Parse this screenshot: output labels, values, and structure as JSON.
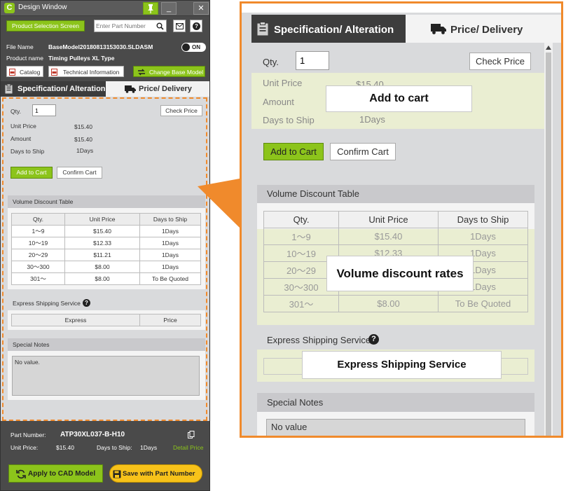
{
  "window": {
    "title": "Design Window",
    "logo_letter": "C",
    "minimize_glyph": "_",
    "close_glyph": "✕",
    "product_selection_label": "Product Selection Screen",
    "search_placeholder": "Enter Part Number",
    "file_name_label": "File Name",
    "file_name_value": "BaseModel20180813153030.SLDASM",
    "toggle_label": "ON",
    "product_name_label": "Product name",
    "product_name_value": "Timing Pulleys XL Type",
    "catalog_label": "Catalog",
    "tech_info_label": "Technical Information",
    "change_base_label": "Change Base Model"
  },
  "tabs": {
    "spec": "Specification/ Alteration",
    "price": "Price/ Delivery"
  },
  "price": {
    "qty_label": "Qty.",
    "qty_value": "1",
    "check_price": "Check Price",
    "unit_price_label": "Unit Price",
    "unit_price_value": "$15.40",
    "amount_label": "Amount",
    "amount_value": "$15.40",
    "days_label": "Days to Ship",
    "days_value": "1Days",
    "add_to_cart": "Add to Cart",
    "confirm_cart": "Confirm Cart"
  },
  "volume": {
    "title": "Volume Discount Table",
    "headers": [
      "Qty.",
      "Unit Price",
      "Days to Ship"
    ],
    "rows": [
      [
        "1～9",
        "$15.40",
        "1Days"
      ],
      [
        "10～19",
        "$12.33",
        "1Days"
      ],
      [
        "20～29",
        "$11.21",
        "1Days"
      ],
      [
        "30～300",
        "$8.00",
        "1Days"
      ],
      [
        "301～",
        "$8.00",
        "To Be Quoted"
      ]
    ]
  },
  "express": {
    "title": "Express Shipping Service",
    "help_glyph": "?",
    "headers": [
      "Express",
      "Price"
    ]
  },
  "notes": {
    "title": "Special Notes",
    "value": "No value."
  },
  "footer": {
    "part_number_label": "Part Number:",
    "part_number_value": "ATP30XL037-B-H10",
    "unit_price_label": "Unit Price:",
    "unit_price_value": "$15.40",
    "days_label": "Days to Ship:",
    "days_value": "1Days",
    "detail_price": "Detail Price",
    "apply_label": "Apply to CAD Model",
    "save_label": "Save with Part Number"
  },
  "callouts": {
    "add_to_cart": "Add to cart",
    "volume_rates": "Volume discount rates",
    "express": "Express Shipping Service"
  },
  "zoom": {
    "notes_value": "No value"
  },
  "colors": {
    "accent_green": "#8cc41b",
    "highlight_orange": "#f08a2c",
    "save_yellow": "#f7c21a",
    "detail_green": "#8cc41b"
  }
}
